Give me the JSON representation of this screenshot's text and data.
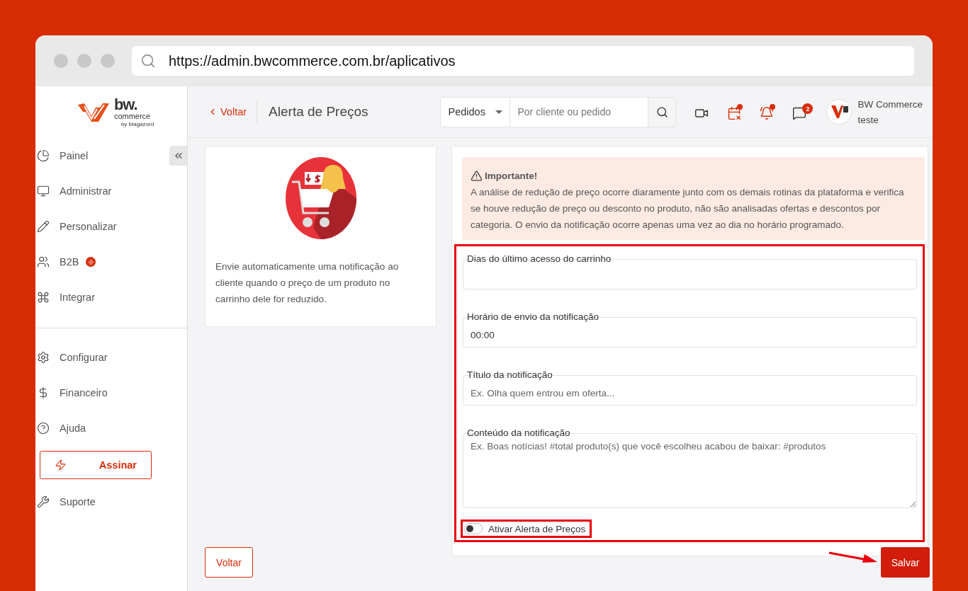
{
  "browser": {
    "url": "https://admin.bwcommerce.com.br/aplicativos"
  },
  "logo": {
    "brand": "bw.",
    "sub": "commerce",
    "by": "by Magazord"
  },
  "sidebar": {
    "sections": [
      {
        "items": [
          {
            "kind": "link",
            "label": "Painel",
            "badge": false
          },
          {
            "kind": "link",
            "label": "Administrar",
            "badge": false
          },
          {
            "kind": "link",
            "label": "Personalizar",
            "badge": false
          },
          {
            "kind": "link",
            "label": "B2B",
            "badge": true
          },
          {
            "kind": "link",
            "label": "Integrar",
            "badge": false
          }
        ]
      },
      {
        "items": [
          {
            "kind": "link",
            "label": "Configurar",
            "badge": false
          },
          {
            "kind": "link",
            "label": "Financeiro",
            "badge": false
          },
          {
            "kind": "link",
            "label": "Ajuda",
            "badge": false
          },
          {
            "kind": "button",
            "label": "Assinar",
            "badge": false
          },
          {
            "kind": "link",
            "label": "Suporte",
            "badge": false
          }
        ]
      }
    ]
  },
  "header": {
    "back": "Voltar",
    "title": "Alerta de Preços",
    "search": {
      "scope": "Pedidos",
      "placeholder": "Por cliente ou pedido"
    },
    "tools": [
      {
        "dot": false
      },
      {
        "dot": true
      },
      {
        "dot": true
      },
      {
        "dot": false,
        "count": "2"
      }
    ],
    "user": {
      "name": "BW Commerce",
      "subtitle": "teste"
    }
  },
  "app_card": {
    "description": "Envie automaticamente uma notificação ao cliente quando o preço de um produto no carrinho dele for reduzido."
  },
  "notice": {
    "title": "Importante!",
    "text": "A análise de redução de preço ocorre diaramente junto com os demais rotinas da plataforma e verifica se houve redução de preço ou desconto no produto, não são analisadas ofertas e descontos por categoria. O envio da notificação ocorre apenas uma vez ao dia no horário programado."
  },
  "form": {
    "fields": [
      {
        "kind": "input",
        "label": "Dias do último acesso do carrinho"
      },
      {
        "kind": "input",
        "label": "Horário de envio da notificação",
        "value": "00:00"
      },
      {
        "kind": "input",
        "label": "Título da notificação",
        "placeholder": "Ex. Olha quem entrou em oferta..."
      },
      {
        "kind": "textarea",
        "label": "Conteúdo da notificação",
        "placeholder": "Ex. Boas notícias! #total produto(s) que você escolheu acabou de baixar: #produtos"
      }
    ],
    "toggle": {
      "label": "Ativar Alerta de Preços",
      "on": false
    }
  },
  "footer": {
    "back": "Voltar",
    "save": "Salvar"
  }
}
